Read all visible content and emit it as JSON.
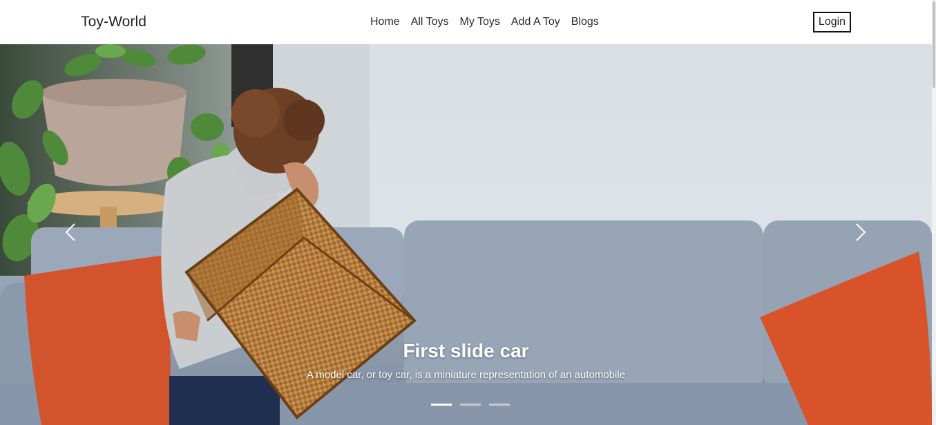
{
  "nav": {
    "brand": "Toy-World",
    "links": [
      "Home",
      "All Toys",
      "My Toys",
      "Add A Toy",
      "Blogs"
    ],
    "login_label": "Login"
  },
  "carousel": {
    "slide_image": "child-with-wicker-basket-photo",
    "caption_title": "First slide car",
    "caption_text": "A model car, or toy car, is a miniature representation of an automobile",
    "prev_icon": "chevron-left-icon",
    "next_icon": "chevron-right-icon",
    "slide_count": 3,
    "active_slide": 1
  },
  "colors": {
    "nav_bg": "#ffffff",
    "text": "#222222",
    "caption_text": "#ffffff"
  }
}
